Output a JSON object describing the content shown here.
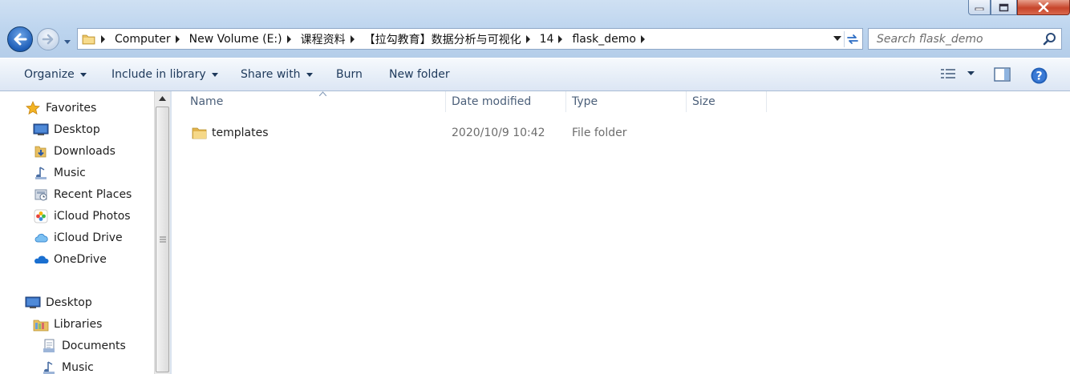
{
  "window": {
    "minimize_icon": "minimize-icon",
    "maximize_icon": "maximize-icon",
    "close_icon": "close-icon"
  },
  "address_bar": {
    "breadcrumbs": [
      "Computer",
      "New Volume (E:)",
      "课程资料",
      "【拉勾教育】数据分析与可视化",
      "14",
      "flask_demo"
    ]
  },
  "search": {
    "placeholder": "Search flask_demo"
  },
  "toolbar": {
    "organize": "Organize",
    "include_in_library": "Include in library",
    "share_with": "Share with",
    "burn": "Burn",
    "new_folder": "New folder"
  },
  "nav_pane": {
    "favorites": "Favorites",
    "desktop": "Desktop",
    "downloads": "Downloads",
    "music": "Music",
    "recent_places": "Recent Places",
    "icloud_photos": "iCloud Photos",
    "icloud_drive": "iCloud Drive",
    "onedrive": "OneDrive",
    "desktop_root": "Desktop",
    "libraries": "Libraries",
    "documents": "Documents",
    "music_lib": "Music"
  },
  "columns": {
    "name": "Name",
    "date_modified": "Date modified",
    "type": "Type",
    "size": "Size"
  },
  "files": [
    {
      "name": "templates",
      "date_modified": "2020/10/9 10:42",
      "type": "File folder",
      "size": ""
    }
  ],
  "colors": {
    "chrome": "#c9dcf0",
    "accent": "#1f5fb8",
    "folder": "#e9c062",
    "toolbar_text": "#1e395b"
  }
}
